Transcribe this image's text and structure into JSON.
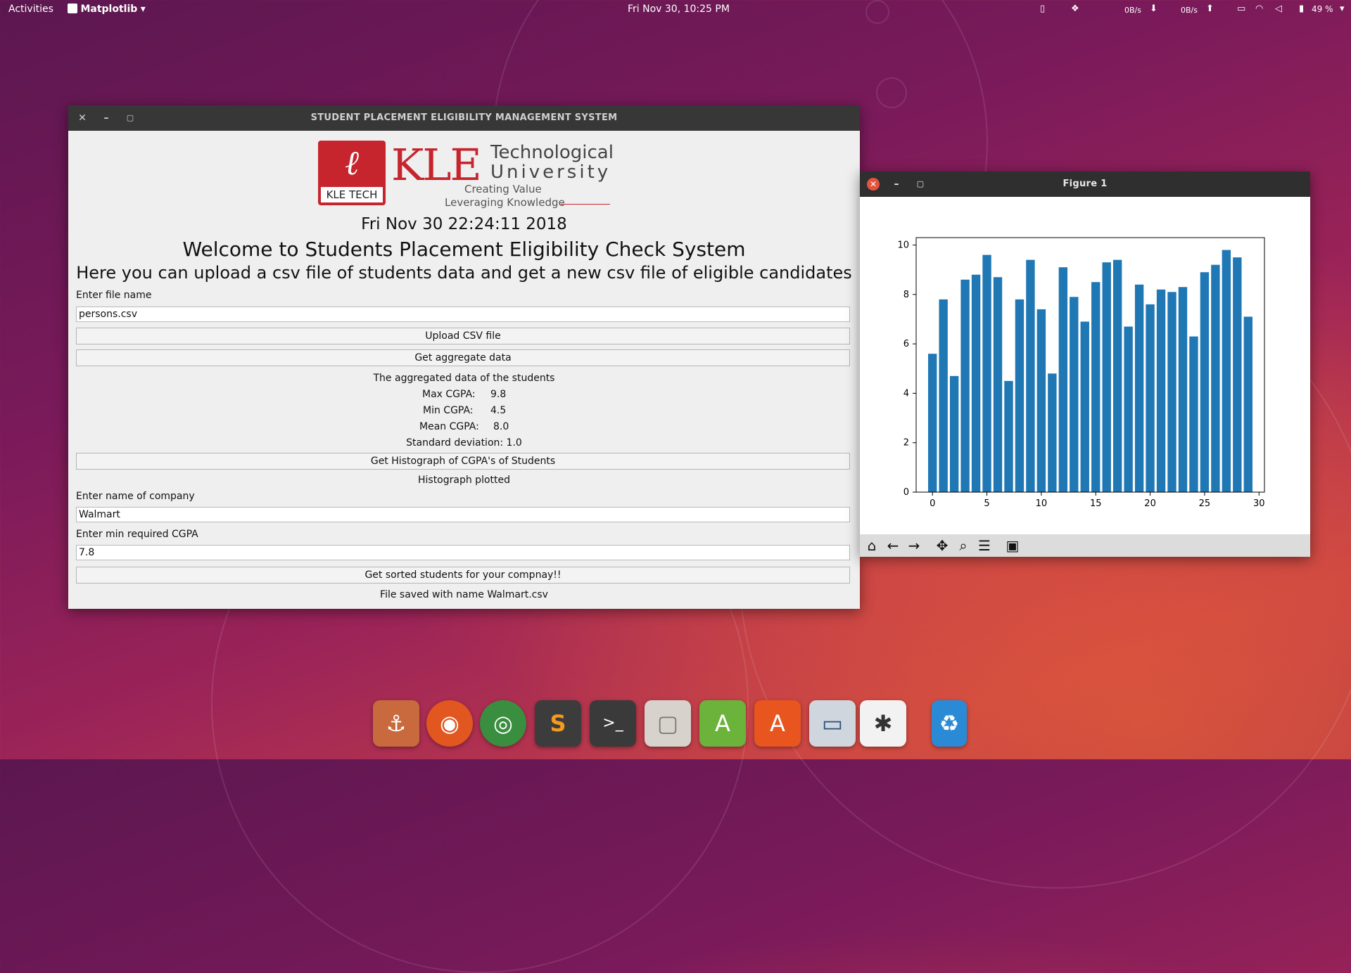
{
  "topbar": {
    "activities": "Activities",
    "app_name": "Matplotlib",
    "clock": "Fri Nov 30, 10:25 PM",
    "net_down": "0B/s",
    "net_up": "0B/s",
    "battery": "49 %"
  },
  "main_window": {
    "title": "STUDENT PLACEMENT ELIGIBILITY MANAGEMENT SYSTEM",
    "logo": {
      "badge": "KLE TECH",
      "wordmark": "KLE",
      "line1": "Technological",
      "line2": "University",
      "tag1": "Creating Value",
      "tag2": "Leveraging Knowledge"
    },
    "datetime": "Fri Nov 30 22:24:11 2018",
    "welcome": "Welcome to Students Placement Eligibility Check System",
    "subtitle": "Here you can upload a csv file of students data and get a new csv file of eligible candidates",
    "file_label": "Enter file name",
    "file_value": "persons.csv",
    "upload_button": "Upload CSV file",
    "aggregate_button": "Get aggregate data",
    "aggregate_heading": "The aggregated data of the students",
    "max_label": "Max CGPA:",
    "max_value": "9.8",
    "min_label": "Min CGPA:",
    "min_value": "4.5",
    "mean_label": "Mean CGPA:",
    "mean_value": "8.0",
    "std_text": "Standard deviation: 1.0",
    "histogram_button": "Get Histograph of CGPA's of Students",
    "histogram_status": "Histograph plotted",
    "company_label": "Enter name of company",
    "company_value": "Walmart",
    "cgpa_label": "Enter min required CGPA",
    "cgpa_value": "7.8",
    "sort_button": "Get sorted students for your compnay!!",
    "saved_status": "File saved with name Walmart.csv"
  },
  "figure_window": {
    "title": "Figure 1"
  },
  "chart_data": {
    "type": "bar",
    "x": [
      0,
      1,
      2,
      3,
      4,
      5,
      6,
      7,
      8,
      9,
      10,
      11,
      12,
      13,
      14,
      15,
      16,
      17,
      18,
      19,
      20,
      21,
      22,
      23,
      24,
      25,
      26,
      27,
      28,
      29
    ],
    "values": [
      5.6,
      7.8,
      4.7,
      8.6,
      8.8,
      9.6,
      8.7,
      4.5,
      7.8,
      9.4,
      7.4,
      4.8,
      9.1,
      7.9,
      6.9,
      8.5,
      9.3,
      9.4,
      6.7,
      8.4,
      7.6,
      8.2,
      8.1,
      8.3,
      6.3,
      8.9,
      9.2,
      9.8,
      9.5,
      7.1
    ],
    "xticks": [
      0,
      5,
      10,
      15,
      20,
      25,
      30
    ],
    "yticks": [
      0,
      2,
      4,
      6,
      8,
      10
    ],
    "xlim": [
      -1.5,
      30.5
    ],
    "ylim": [
      0,
      10.3
    ],
    "bar_color": "#1f77b4",
    "title": "",
    "xlabel": "",
    "ylabel": ""
  },
  "dock": {
    "apps": [
      "anchor-app-icon",
      "firefox-icon",
      "chrome-icon",
      "sublime-text-icon",
      "terminal-icon",
      "files-icon",
      "android-studio-icon",
      "software-center-icon",
      "window-icon",
      "pinwheel-app-icon",
      "trash-icon"
    ]
  }
}
